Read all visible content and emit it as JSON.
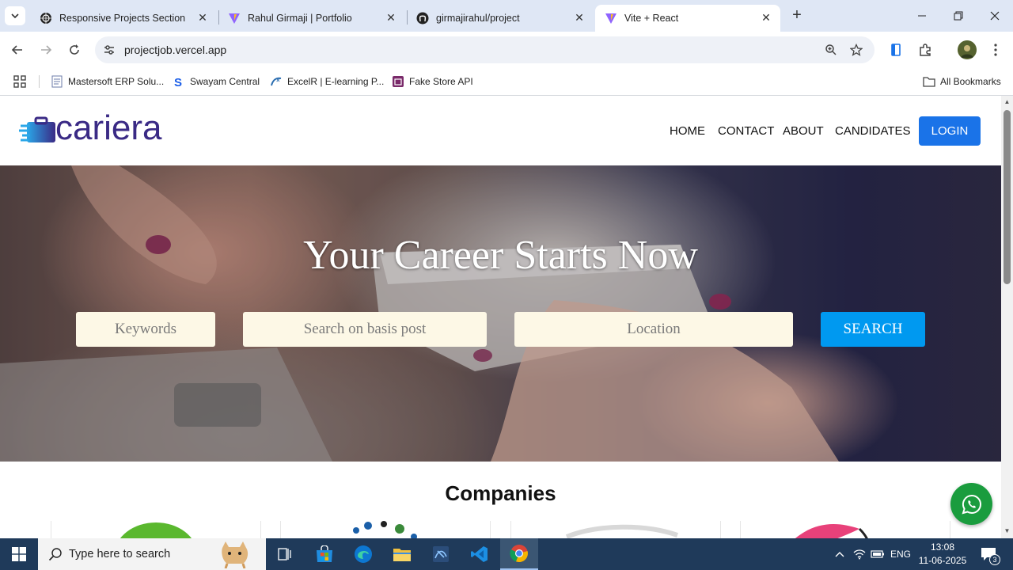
{
  "browser": {
    "tabs": [
      {
        "title": "Responsive Projects Section",
        "active": false,
        "icon": "globe-icon"
      },
      {
        "title": "Rahul Girmaji | Portfolio",
        "active": false,
        "icon": "vite-icon"
      },
      {
        "title": "girmajirahul/project",
        "active": false,
        "icon": "github-icon"
      },
      {
        "title": "Vite + React",
        "active": true,
        "icon": "vite-icon"
      }
    ],
    "url": "projectjob.vercel.app",
    "bookmarks": [
      {
        "label": "Mastersoft ERP Solu..."
      },
      {
        "label": "Swayam Central"
      },
      {
        "label": "ExcelR | E-learning P..."
      },
      {
        "label": "Fake Store API"
      }
    ],
    "all_bookmarks_label": "All Bookmarks"
  },
  "site": {
    "logo_text": "cariera",
    "nav": [
      "HOME",
      "CONTACT",
      "ABOUT",
      "CANDIDATES"
    ],
    "login_label": "LOGIN",
    "hero": {
      "title": "Your Career Starts Now",
      "keywords_placeholder": "Keywords",
      "post_placeholder": "Search on basis post",
      "location_placeholder": "Location",
      "search_label": "SEARCH"
    },
    "companies_title": "Companies"
  },
  "taskbar": {
    "search_placeholder": "Type here to search",
    "language": "ENG",
    "time": "13:08",
    "date": "11-06-2025",
    "notification_count": "3"
  },
  "colors": {
    "accent_blue": "#1a73e8",
    "search_button": "#0099f0",
    "logo_purple": "#3a2a85",
    "whatsapp_green": "#1a9c3e"
  }
}
